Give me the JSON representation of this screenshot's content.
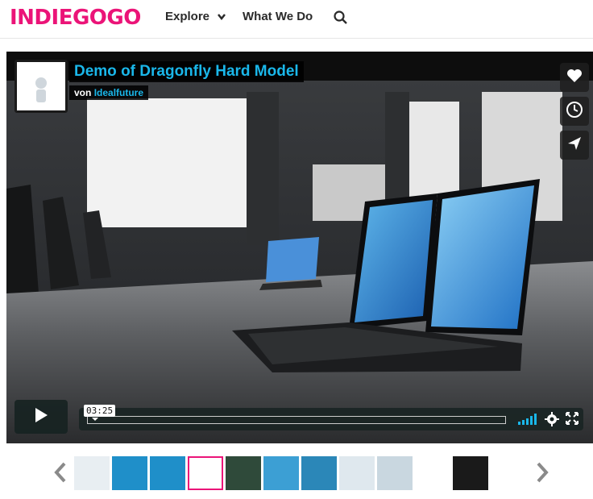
{
  "header": {
    "logo": "INDIEGOGO",
    "nav": {
      "explore": "Explore",
      "what_we_do": "What We Do"
    },
    "search_icon": "search-icon"
  },
  "video": {
    "title": "Demo of Dragonfly Hard Model",
    "byline_prefix": "von",
    "author": "Idealfuture",
    "timecode": "03:25",
    "progress": 0.0,
    "side_actions": [
      "heart-icon",
      "clock-icon",
      "paper-plane-icon"
    ],
    "controls": [
      "play-icon",
      "volume-icon",
      "gear-icon",
      "fullscreen-icon"
    ]
  },
  "gallery": {
    "thumbnail_count": 12,
    "selected_index": 3,
    "prev_icon": "chevron-left-icon",
    "next_icon": "chevron-right-icon"
  },
  "colors": {
    "brand": "#eb1478",
    "vimeo_blue": "#1ab7ea",
    "control_bg": "#172322"
  }
}
